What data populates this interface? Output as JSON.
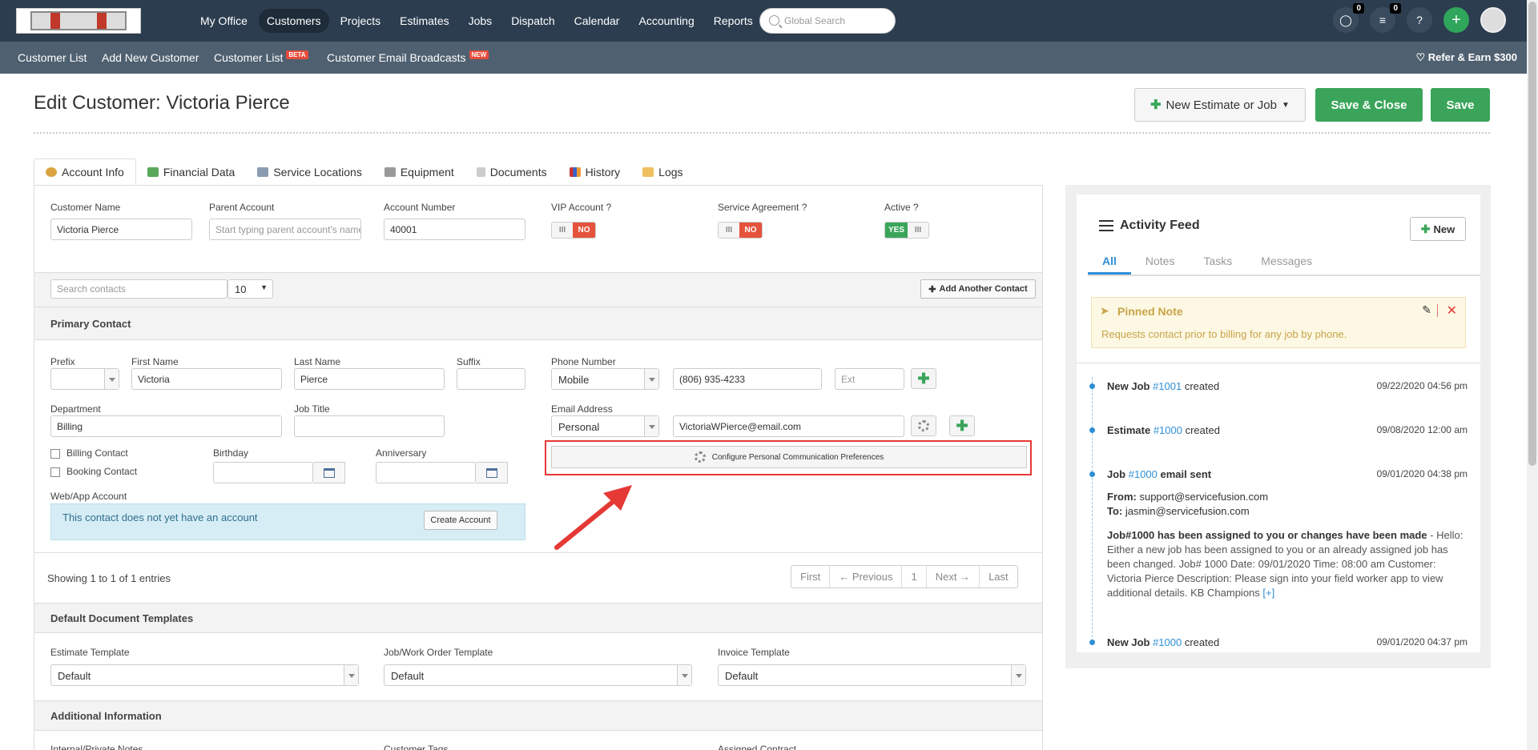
{
  "nav": {
    "items": [
      "My Office",
      "Customers",
      "Projects",
      "Estimates",
      "Jobs",
      "Dispatch",
      "Calendar",
      "Accounting",
      "Reports"
    ],
    "search_placeholder": "Global Search",
    "chat_count": "0",
    "list_count": "0",
    "help": "?",
    "add": "+"
  },
  "subnav": {
    "customer_list": "Customer List",
    "add_new": "Add New Customer",
    "customer_list_beta": "Customer List",
    "beta": "BETA",
    "email_broadcasts": "Customer Email Broadcasts",
    "new": "NEW",
    "refer": "Refer & Earn $300"
  },
  "header": {
    "title": "Edit Customer: Victoria Pierce",
    "new_estimate": "New Estimate or Job",
    "save_close": "Save & Close",
    "save": "Save"
  },
  "tabs": [
    "Account Info",
    "Financial Data",
    "Service Locations",
    "Equipment",
    "Documents",
    "History",
    "Logs"
  ],
  "account": {
    "customer_name_label": "Customer Name",
    "customer_name": "Victoria Pierce",
    "parent_label": "Parent Account",
    "parent_placeholder": "Start typing parent account's name",
    "account_number_label": "Account Number",
    "account_number": "40001",
    "vip_label": "VIP Account ?",
    "vip_value": "NO",
    "service_label": "Service Agreement ?",
    "service_value": "NO",
    "active_label": "Active ?",
    "active_value": "YES",
    "toggle_knob": "III"
  },
  "contacts": {
    "search_placeholder": "Search contacts",
    "page_size": "10",
    "add_contact": "Add Another Contact",
    "primary_title": "Primary Contact",
    "prefix_label": "Prefix",
    "first_label": "First Name",
    "first": "Victoria",
    "last_label": "Last Name",
    "last": "Pierce",
    "suffix_label": "Suffix",
    "phone_label": "Phone Number",
    "phone_type": "Mobile",
    "phone": "(806) 935-4233",
    "ext_placeholder": "Ext",
    "dept_label": "Department",
    "dept": "Billing",
    "job_title_label": "Job Title",
    "email_label": "Email Address",
    "email_type": "Personal",
    "email": "VictoriaWPierce@email.com",
    "billing_contact": "Billing Contact",
    "booking_contact": "Booking Contact",
    "birthday_label": "Birthday",
    "anniversary_label": "Anniversary",
    "configure": "Configure Personal Communication Preferences",
    "web_label": "Web/App Account",
    "no_account": "This contact does not yet have an account",
    "create_account": "Create Account",
    "showing": "Showing 1 to 1 of 1 entries",
    "pager": [
      "First",
      "← Previous",
      "1",
      "Next →",
      "Last"
    ]
  },
  "templates": {
    "title": "Default Document Templates",
    "estimate_label": "Estimate Template",
    "estimate": "Default",
    "job_label": "Job/Work Order Template",
    "job": "Default",
    "invoice_label": "Invoice Template",
    "invoice": "Default"
  },
  "additional": {
    "title": "Additional Information",
    "notes_label": "Internal/Private Notes",
    "tags_label": "Customer Tags",
    "contract_label": "Assigned Contract"
  },
  "activity": {
    "title": "Activity Feed",
    "new": "New",
    "tabs": [
      "All",
      "Notes",
      "Tasks",
      "Messages"
    ],
    "pinned_title": "Pinned Note",
    "pinned_text": "Requests contact prior to billing for any job by phone.",
    "events": [
      {
        "pre": "New Job ",
        "link": "#1001",
        "post": " created",
        "date": "09/22/2020 04:56 pm"
      },
      {
        "pre": "Estimate ",
        "link": "#1000",
        "post": " created",
        "date": "09/08/2020 12:00 am"
      },
      {
        "pre": "Job ",
        "link": "#1000",
        "post": " email sent",
        "date": "09/01/2020 04:38 pm"
      },
      {
        "pre": "New Job ",
        "link": "#1000",
        "post": " created",
        "date": "09/01/2020 04:37 pm"
      }
    ],
    "from_label": "From:",
    "from": "support@servicefusion.com",
    "to_label": "To:",
    "to": "jasmin@servicefusion.com",
    "email_subject": "Job#1000 has been assigned to you or changes have been made",
    "email_body": "Hello:   Either a new job has been assigned to you or an already assigned job has been changed.   Job# 1000 Date: 09/01/2020 Time:   08:00 am Customer: Victoria Pierce Description:   Please sign into your field worker app to view additional details.   KB Champions",
    "more": "[+]"
  }
}
